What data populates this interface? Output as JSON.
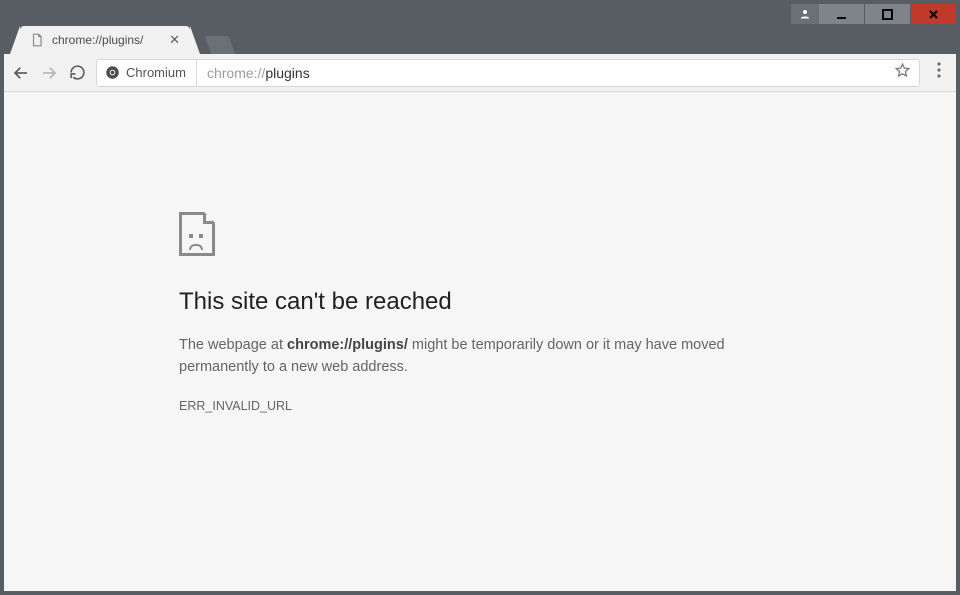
{
  "tab": {
    "title": "chrome://plugins/"
  },
  "omnibox": {
    "chip_label": "Chromium",
    "url_prefix": "chrome://",
    "url_bold": "plugins"
  },
  "error": {
    "heading": "This site can't be reached",
    "body_pre": "The webpage at ",
    "body_url": "chrome://plugins/",
    "body_post": " might be temporarily down or it may have moved permanently to a new web address.",
    "code": "ERR_INVALID_URL"
  }
}
